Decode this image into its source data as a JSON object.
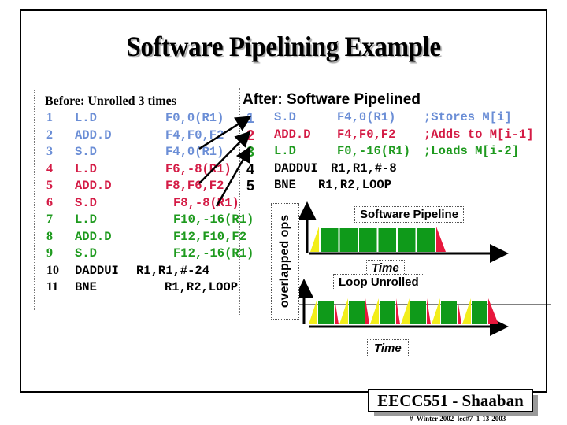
{
  "slide": {
    "title": "Software Pipelining Example",
    "footer": "EECC551 - Shaaban",
    "footnote": "#  Winter 2002  lec#7  1-13-2003"
  },
  "before": {
    "heading": "Before: Unrolled 3 times",
    "rows": [
      {
        "n": "1",
        "op": "L.D",
        "args": "F0,0(R1)",
        "color": "blue"
      },
      {
        "n": "2",
        "op": "ADD.D",
        "args": "F4,F0,F2",
        "color": "blue"
      },
      {
        "n": "3",
        "op": "S.D",
        "args": "F4,0(R1)",
        "color": "blue"
      },
      {
        "n": "4",
        "op": "L.D",
        "args": "F6,-8(R1)",
        "color": "red"
      },
      {
        "n": "5",
        "op": "ADD.D",
        "args": "F8,F6,F2",
        "color": "red"
      },
      {
        "n": "6",
        "op": "S.D",
        "args": "F8,-8(R1)",
        "color": "red"
      },
      {
        "n": "7",
        "op": "L.D",
        "args": "F10,-16(R1)",
        "color": "green"
      },
      {
        "n": "8",
        "op": "ADD.D",
        "args": "F12,F10,F2",
        "color": "green"
      },
      {
        "n": "9",
        "op": "S.D",
        "args": "F12,-16(R1)",
        "color": "green"
      },
      {
        "n": "10",
        "op": "DADDUI",
        "args": "R1,R1,#-24",
        "color": "black"
      },
      {
        "n": "11",
        "op": "BNE",
        "args": "R1,R2,LOOP",
        "color": "black"
      }
    ]
  },
  "after": {
    "heading": "After: Software Pipelined",
    "rows": [
      {
        "n": "1",
        "op": "S.D",
        "args": "F4,0(R1)",
        "comment": ";Stores M[i]",
        "color": "blue"
      },
      {
        "n": "2",
        "op": "ADD.D",
        "args": "F4,F0,F2",
        "comment": ";Adds to M[i-1]",
        "color": "red"
      },
      {
        "n": "3",
        "op": "L.D",
        "args": "F0,-16(R1)",
        "comment": ";Loads M[i-2]",
        "color": "green"
      },
      {
        "n": "4",
        "op": "DADDUI",
        "args": "R1,R1,#-8",
        "comment": "",
        "color": "black"
      },
      {
        "n": "5",
        "op": "BNE",
        "args": "R1,R2,LOOP",
        "comment": "",
        "color": "black"
      }
    ]
  },
  "diagram": {
    "y_axis_label": "overlapped ops",
    "software_pipeline_label": "Software Pipeline",
    "loop_unrolled_label": "Loop Unrolled",
    "time_label_1": "Time",
    "time_label_2": "Time",
    "software_pipeline_blocks": 6,
    "loop_unrolled_blocks": 6,
    "colors": {
      "startup": "#f2ee1a",
      "steady": "#0f9a1a",
      "wind_down": "#e8173c"
    }
  }
}
